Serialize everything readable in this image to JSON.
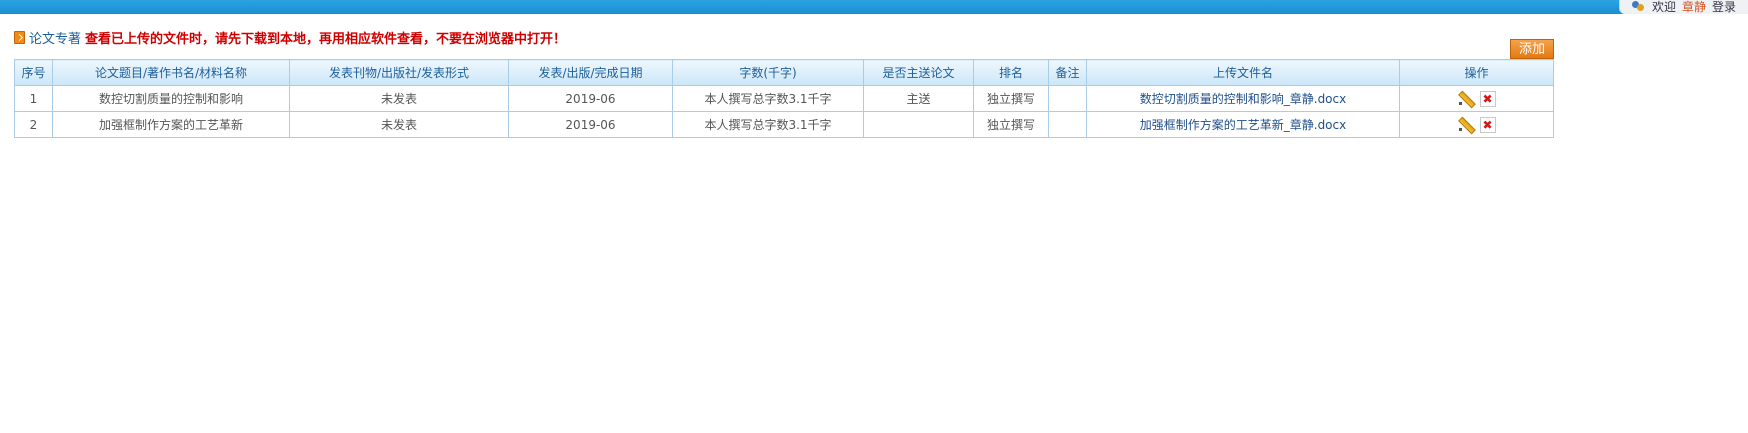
{
  "header": {
    "welcome_prefix": "欢迎",
    "username": "章静",
    "login_label": "登录"
  },
  "section": {
    "title": "论文专著",
    "warning": "查看已上传的文件时，请先下载到本地，再用相应软件查看，不要在浏览器中打开！",
    "add_label": "添加"
  },
  "table": {
    "headers": [
      "序号",
      "论文题目/著作书名/材料名称",
      "发表刊物/出版社/发表形式",
      "发表/出版/完成日期",
      "字数(千字)",
      "是否主送论文",
      "排名",
      "备注",
      "上传文件名",
      "操作"
    ],
    "rows": [
      {
        "index": "1",
        "title": "数控切割质量的控制和影响",
        "publication": "未发表",
        "date": "2019-06",
        "words": "本人撰写总字数3.1千字",
        "is_main": "主送",
        "rank": "独立撰写",
        "remark": "",
        "file": "数控切割质量的控制和影响_章静.docx"
      },
      {
        "index": "2",
        "title": "加强框制作方案的工艺革新",
        "publication": "未发表",
        "date": "2019-06",
        "words": "本人撰写总字数3.1千字",
        "is_main": "",
        "rank": "独立撰写",
        "remark": "",
        "file": "加强框制作方案的工艺革新_章静.docx"
      }
    ]
  },
  "icons": {
    "section": "document-icon",
    "edit": "pencil-edit-icon",
    "delete": "red-x-delete-icon",
    "user": "user-icon"
  },
  "colors": {
    "topbar": "#1b8fd2",
    "add_button": "#e47a12",
    "warning_text": "#d00000",
    "header_text": "#1f5f99"
  }
}
